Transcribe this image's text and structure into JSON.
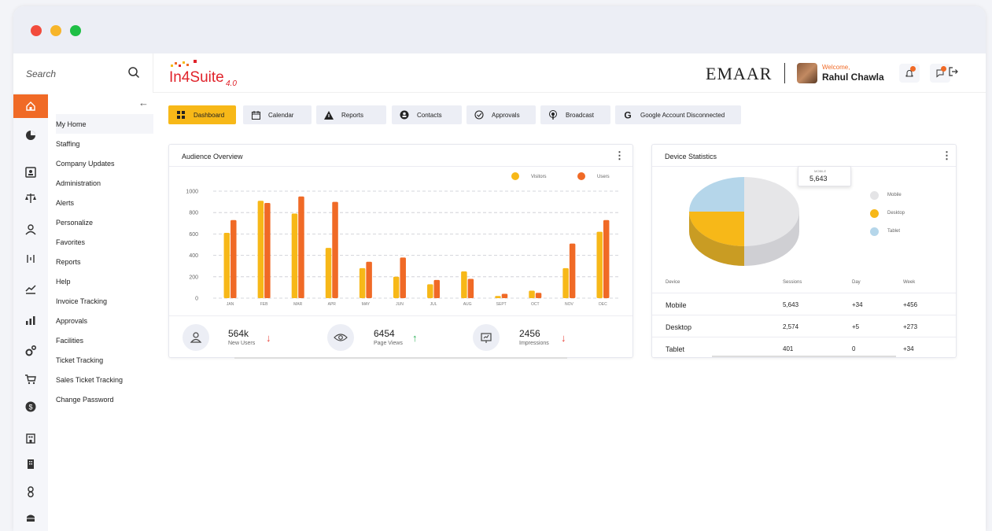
{
  "window": {
    "controls": [
      "close",
      "minimize",
      "maximize"
    ]
  },
  "search": {
    "placeholder": "Search"
  },
  "rail_icons": [
    "home-icon",
    "pie-chart-icon",
    "id-card-icon",
    "scales-icon",
    "user-icon",
    "sort-icon",
    "trend-icon",
    "bar-chart-icon",
    "gears-icon",
    "cart-icon",
    "dollar-icon",
    "building-icon",
    "tower-icon",
    "people-icon",
    "archive-icon"
  ],
  "nav": {
    "items": [
      {
        "label": "My Home"
      },
      {
        "label": "Staffing"
      },
      {
        "label": "Company Updates"
      },
      {
        "label": "Administration"
      },
      {
        "label": "Alerts"
      },
      {
        "label": "Personalize"
      },
      {
        "label": "Favorites"
      },
      {
        "label": "Reports"
      },
      {
        "label": "Help"
      },
      {
        "label": "Invoice Tracking"
      },
      {
        "label": "Approvals"
      },
      {
        "label": "Facilities"
      },
      {
        "label": "Ticket Tracking"
      },
      {
        "label": "Sales Ticket Tracking"
      },
      {
        "label": "Change Password"
      }
    ],
    "active_index": 0
  },
  "header": {
    "logo_text": "In4Suite",
    "logo_version": "4.0",
    "brand": "EMAAR",
    "welcome": "Welcome,",
    "user_name": "Rahul Chawla"
  },
  "tabs": [
    {
      "label": "Dashboard",
      "icon": "dashboard-icon"
    },
    {
      "label": "Calendar",
      "icon": "calendar-icon"
    },
    {
      "label": "Reports",
      "icon": "warning-icon"
    },
    {
      "label": "Contacts",
      "icon": "contact-icon"
    },
    {
      "label": "Approvals",
      "icon": "check-circle-icon"
    },
    {
      "label": "Broadcast",
      "icon": "broadcast-icon"
    },
    {
      "label": "Google Account Disconnected",
      "icon": "google-icon"
    }
  ],
  "audience": {
    "title": "Audience Overview",
    "stats": [
      {
        "value": "564k",
        "label": "New Users",
        "trend": "down"
      },
      {
        "value": "6454",
        "label": "Page Views",
        "trend": "up"
      },
      {
        "value": "2456",
        "label": "Impressions",
        "trend": "down"
      }
    ]
  },
  "chart_data": {
    "type": "bar",
    "categories": [
      "JAN",
      "FEB",
      "MAR",
      "APR",
      "MAY",
      "JUN",
      "JUL",
      "AUG",
      "SEPT",
      "OCT",
      "NOV",
      "DEC"
    ],
    "series": [
      {
        "name": "Visitors",
        "color": "#f7b818",
        "values": [
          610,
          910,
          790,
          470,
          280,
          200,
          130,
          250,
          20,
          70,
          280,
          620
        ]
      },
      {
        "name": "Users",
        "color": "#f06a26",
        "values": [
          730,
          890,
          950,
          900,
          340,
          380,
          170,
          180,
          40,
          50,
          510,
          730
        ]
      }
    ],
    "yticks": [
      0,
      200,
      400,
      600,
      800,
      1000
    ],
    "ylim": [
      0,
      1000
    ],
    "legend": "top-right",
    "grid": true
  },
  "device": {
    "title": "Device Statistics",
    "tooltip": {
      "label": "MOBILE",
      "value": "5,643"
    },
    "legend": [
      {
        "label": "Mobile",
        "color": "#e4e4e6"
      },
      {
        "label": "Desktop",
        "color": "#f7b818"
      },
      {
        "label": "Tablet",
        "color": "#b5d6ea"
      }
    ],
    "table": {
      "headers": [
        "Device",
        "Sessions",
        "Day",
        "Week"
      ],
      "rows": [
        [
          "Mobile",
          "5,643",
          "+34",
          "+456"
        ],
        [
          "Desktop",
          "2,574",
          "+5",
          "+273"
        ],
        [
          "Tablet",
          "401",
          "0",
          "+34"
        ]
      ]
    }
  }
}
